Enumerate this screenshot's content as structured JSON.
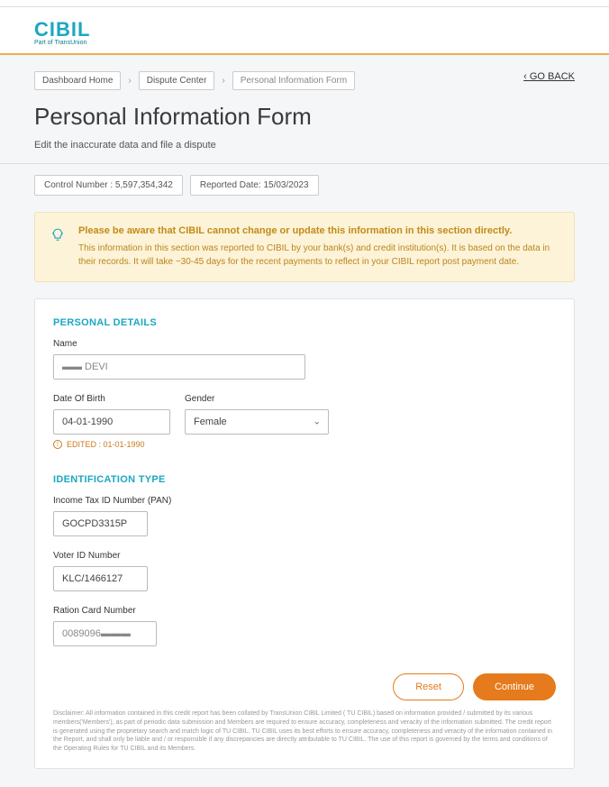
{
  "header": {
    "logo": "CIBIL",
    "logo_sub": "Part of TransUnion"
  },
  "nav": {
    "breadcrumb": {
      "dashboard": "Dashboard Home",
      "dispute": "Dispute Center",
      "current": "Personal Information Form"
    },
    "goback": "GO BACK"
  },
  "page": {
    "title": "Personal Information Form",
    "subtitle": "Edit the inaccurate data and file a dispute"
  },
  "status": {
    "control": "Control Number : 5,597,354,342",
    "reported": "Reported Date: 15/03/2023"
  },
  "notice": {
    "title": "Please be aware that CIBIL cannot change or update this information in this section directly.",
    "body": "This information in this section was reported to CIBIL by your bank(s) and credit institution(s). It is based on the data in their records. It will take ~30-45 days for the recent payments to reflect in your CIBIL report post payment date."
  },
  "form": {
    "personal": {
      "section_title": "PERSONAL DETAILS",
      "name_label": "Name",
      "name_value": "▬▬ DEVI",
      "dob_label": "Date Of Birth",
      "dob_value": "04-01-1990",
      "gender_label": "Gender",
      "gender_value": "Female",
      "edited_note": "EDITED : 01-01-1990"
    },
    "identification": {
      "section_title": "IDENTIFICATION TYPE",
      "pan_label": "Income Tax ID Number (PAN)",
      "pan_value": "GOCPD3315P",
      "voter_label": "Voter ID Number",
      "voter_value": "KLC/1466127",
      "ration_label": "Ration Card Number",
      "ration_value": "0089096▬▬▬"
    }
  },
  "buttons": {
    "reset": "Reset",
    "continue": "Continue"
  },
  "disclaimer": "Disclaimer: All information contained in this credit report has been collated by TransUnion CIBIL Limited ( TU CIBIL) based on information provided / submitted by its various members('Members'), as part of periodic data submission and Members are required to ensure accuracy, completeness and veracity of the information submitted. The credit report is generated using the proprietary search and match logic of TU CIBIL. TU CIBIL uses its best efforts to ensure accuracy, completeness and veracity of the information contained in the Report, and shall only be liable and / or responsible if any discrepancies are directly attributable to TU CIBIL. The use of this report is governed by the terms and conditions of the Operating Rules for TU CIBIL and its Members."
}
